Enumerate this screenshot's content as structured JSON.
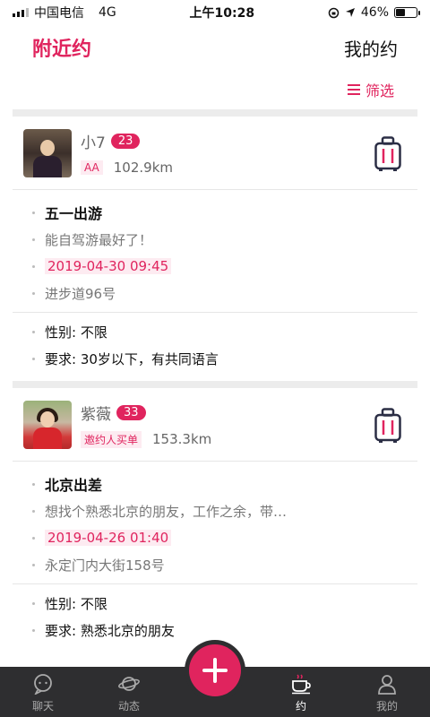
{
  "status": {
    "carrier": "中国电信",
    "network": "4G",
    "time": "上午10:28",
    "battery": "46%",
    "battery_level": 0.46
  },
  "header": {
    "tab_nearby": "附近约",
    "tab_mine": "我的约",
    "filter_label": "筛选"
  },
  "cards": [
    {
      "name": "小7",
      "age": "23",
      "pay": "AA",
      "distance": "102.9km",
      "title": "五一出游",
      "desc": "能自驾游最好了！",
      "date": "2019-04-30 09:45",
      "address": "进步道96号",
      "gender": "性别: 不限",
      "requirement": "要求: 30岁以下，有共同语言"
    },
    {
      "name": "紫薇",
      "age": "33",
      "pay": "邀约人买单",
      "distance": "153.3km",
      "title": "北京出差",
      "desc": "想找个熟悉北京的朋友，工作之余，带…",
      "date": "2019-04-26 01:40",
      "address": "永定门内大街158号",
      "gender": "性别: 不限",
      "requirement": "要求: 熟悉北京的朋友"
    }
  ],
  "tabbar": {
    "chat": "聊天",
    "feed": "动态",
    "date": "约",
    "me": "我的"
  },
  "colors": {
    "accent": "#e0245e",
    "tabbar_bg": "#2e2e30"
  }
}
